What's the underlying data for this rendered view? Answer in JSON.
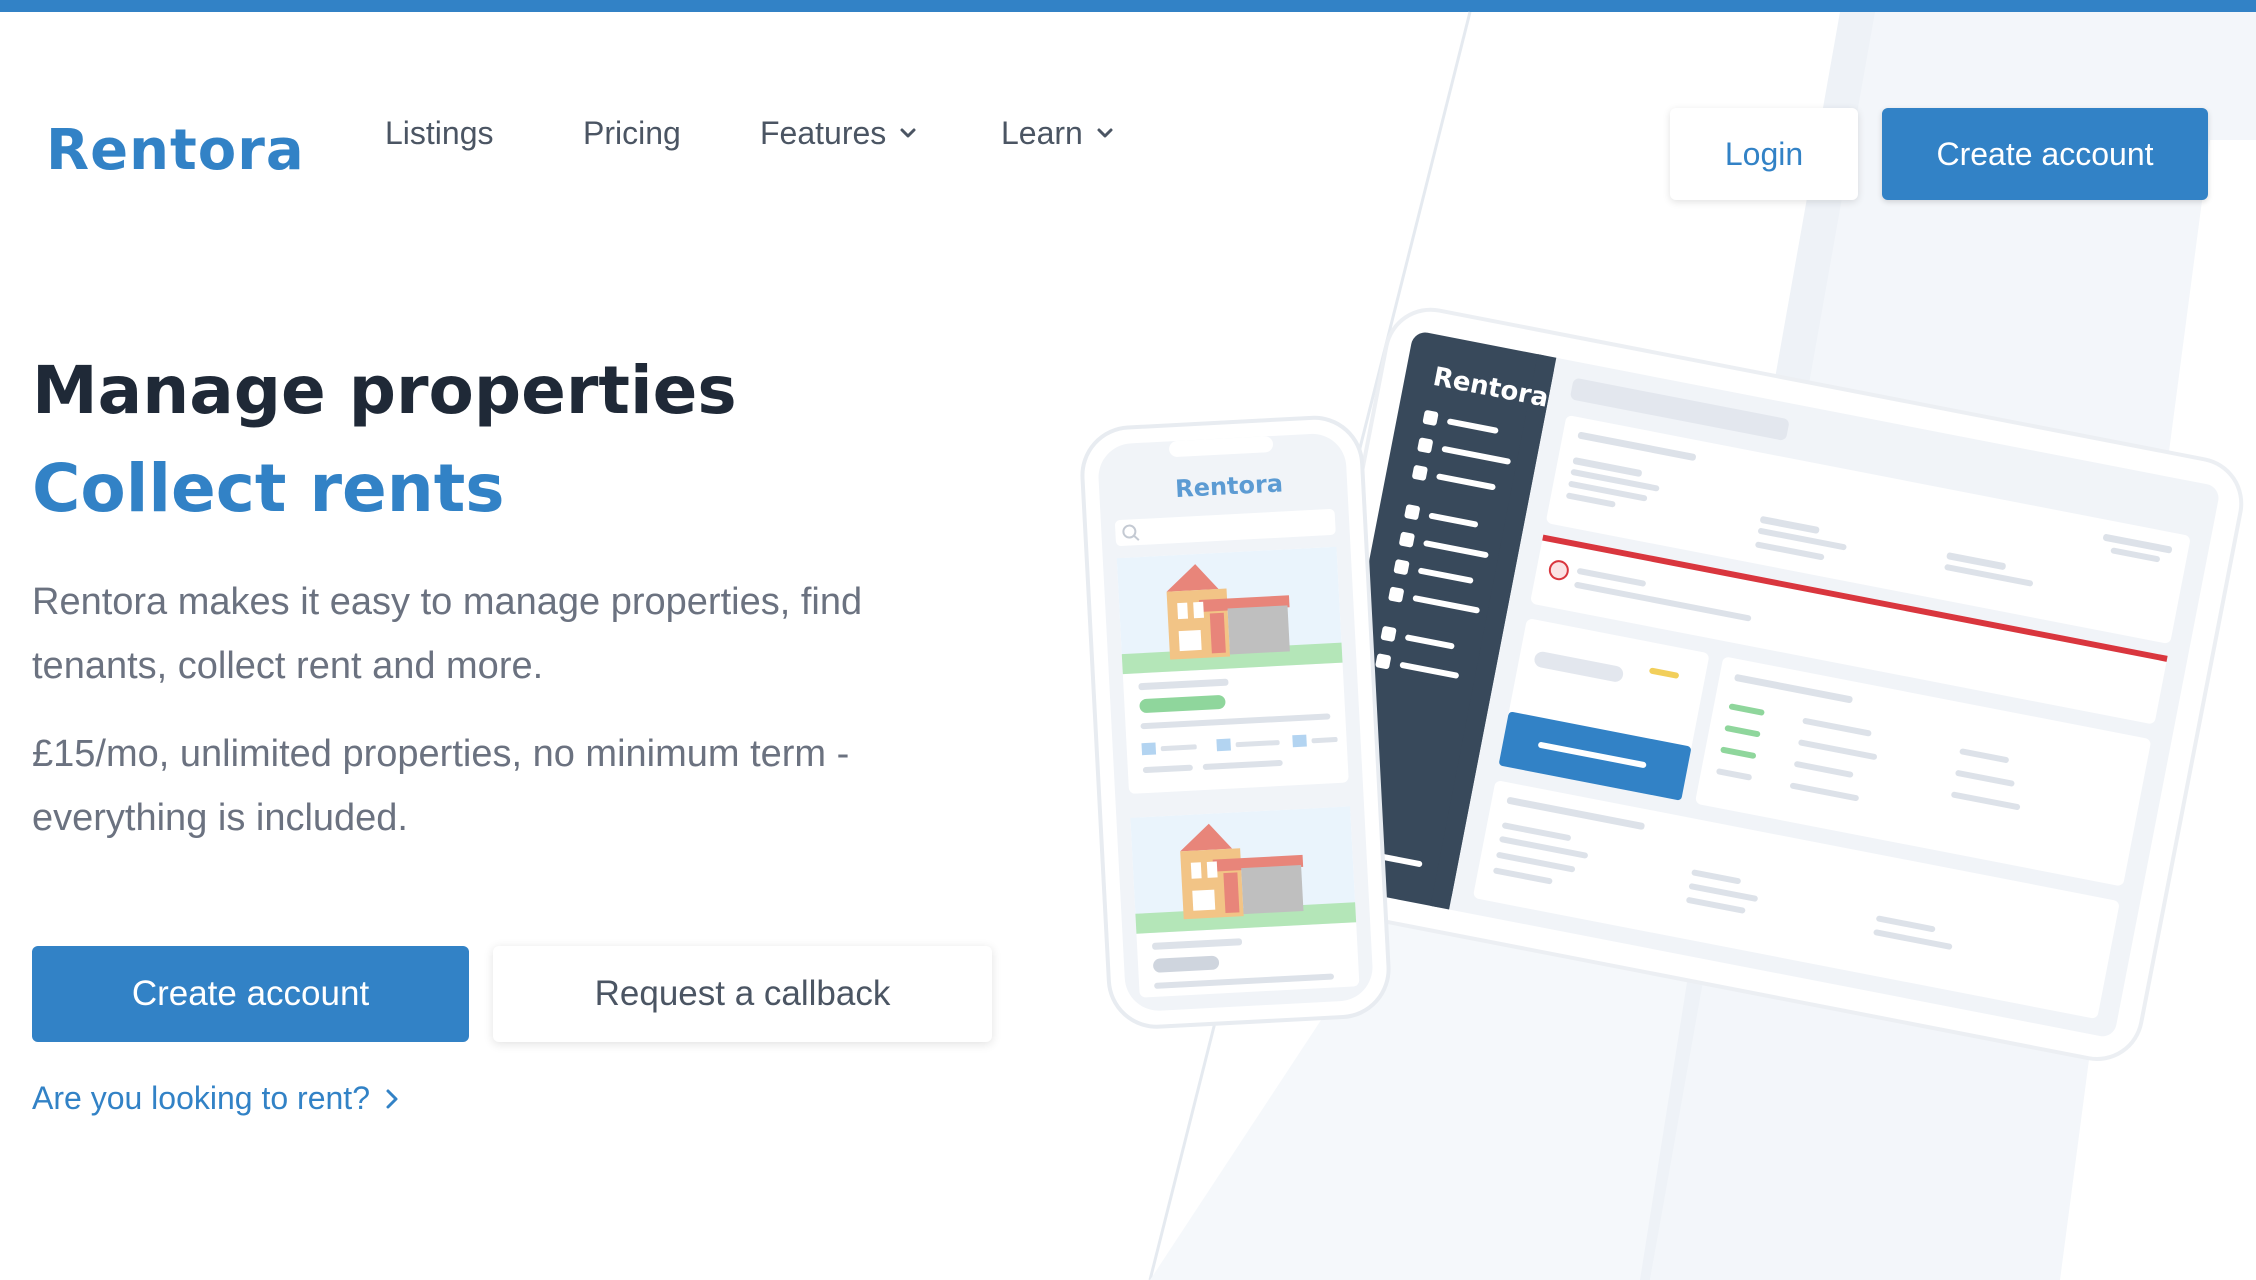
{
  "brand": {
    "name": "Rentora",
    "accent_color": "#3282c6",
    "dark_color": "#1f2937",
    "sidebar_color": "#38495b"
  },
  "nav": {
    "items": [
      {
        "label": "Listings"
      },
      {
        "label": "Pricing"
      },
      {
        "label": "Features",
        "has_dropdown": true
      },
      {
        "label": "Learn",
        "has_dropdown": true
      }
    ],
    "login_label": "Login",
    "create_account_label": "Create account"
  },
  "hero": {
    "title": "Manage properties",
    "subtitle": "Collect rents",
    "paragraph_1": "Rentora makes it easy to manage properties, find tenants, collect rent and more.",
    "paragraph_2": "£15/mo, unlimited properties, no minimum term - everything is included.",
    "primary_button": "Create account",
    "secondary_button": "Request a callback",
    "rent_link": "Are you looking to rent?"
  },
  "illustration": {
    "phone_brand": "Rentora",
    "tablet_brand": "Rentora"
  }
}
